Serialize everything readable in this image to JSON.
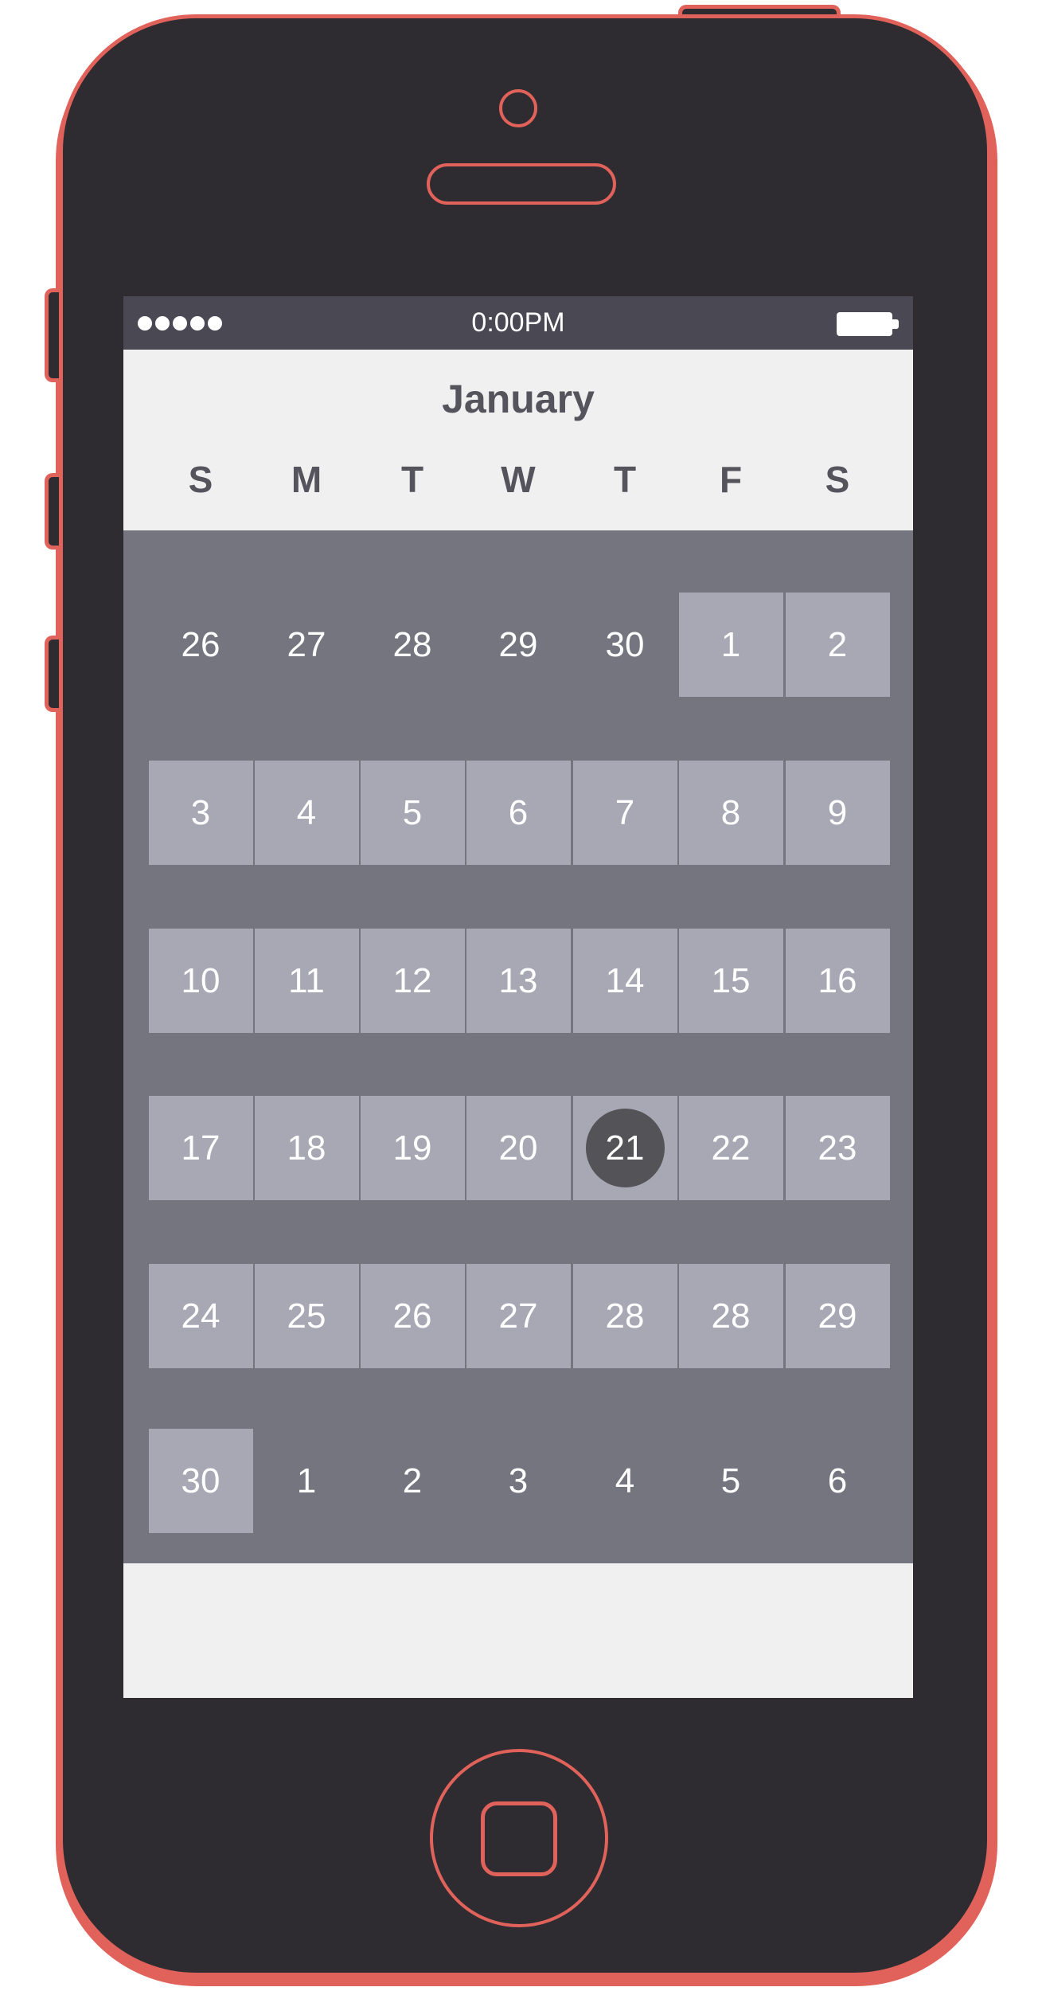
{
  "statusbar": {
    "signal_dots": 5,
    "time": "0:00PM",
    "battery_icon": "battery-full-icon"
  },
  "calendar": {
    "month": "January",
    "weekdays": [
      "S",
      "M",
      "T",
      "W",
      "T",
      "F",
      "S"
    ],
    "weeks": [
      [
        {
          "day": "26",
          "current_month": false
        },
        {
          "day": "27",
          "current_month": false
        },
        {
          "day": "28",
          "current_month": false
        },
        {
          "day": "29",
          "current_month": false
        },
        {
          "day": "30",
          "current_month": false
        },
        {
          "day": "1",
          "current_month": true
        },
        {
          "day": "2",
          "current_month": true
        }
      ],
      [
        {
          "day": "3",
          "current_month": true
        },
        {
          "day": "4",
          "current_month": true
        },
        {
          "day": "5",
          "current_month": true
        },
        {
          "day": "6",
          "current_month": true
        },
        {
          "day": "7",
          "current_month": true
        },
        {
          "day": "8",
          "current_month": true
        },
        {
          "day": "9",
          "current_month": true
        }
      ],
      [
        {
          "day": "10",
          "current_month": true
        },
        {
          "day": "11",
          "current_month": true
        },
        {
          "day": "12",
          "current_month": true
        },
        {
          "day": "13",
          "current_month": true
        },
        {
          "day": "14",
          "current_month": true
        },
        {
          "day": "15",
          "current_month": true
        },
        {
          "day": "16",
          "current_month": true
        }
      ],
      [
        {
          "day": "17",
          "current_month": true
        },
        {
          "day": "18",
          "current_month": true
        },
        {
          "day": "19",
          "current_month": true
        },
        {
          "day": "20",
          "current_month": true
        },
        {
          "day": "21",
          "current_month": true,
          "selected": true
        },
        {
          "day": "22",
          "current_month": true
        },
        {
          "day": "23",
          "current_month": true
        }
      ],
      [
        {
          "day": "24",
          "current_month": true
        },
        {
          "day": "25",
          "current_month": true
        },
        {
          "day": "26",
          "current_month": true
        },
        {
          "day": "27",
          "current_month": true
        },
        {
          "day": "28",
          "current_month": true
        },
        {
          "day": "28",
          "current_month": true
        },
        {
          "day": "29",
          "current_month": true
        }
      ],
      [
        {
          "day": "30",
          "current_month": true
        },
        {
          "day": "1",
          "current_month": false
        },
        {
          "day": "2",
          "current_month": false
        },
        {
          "day": "3",
          "current_month": false
        },
        {
          "day": "4",
          "current_month": false
        },
        {
          "day": "5",
          "current_month": false
        },
        {
          "day": "6",
          "current_month": false
        }
      ]
    ]
  },
  "colors": {
    "phone_body": "#2e2c30",
    "phone_accent": "#e0625a",
    "statusbar_bg": "#494853",
    "screen_bg": "#f1f0f1",
    "grid_bg": "#75757f",
    "day_cell_bg": "#a8a7b4",
    "selected_circle": "#545358",
    "header_text": "#55545c"
  }
}
